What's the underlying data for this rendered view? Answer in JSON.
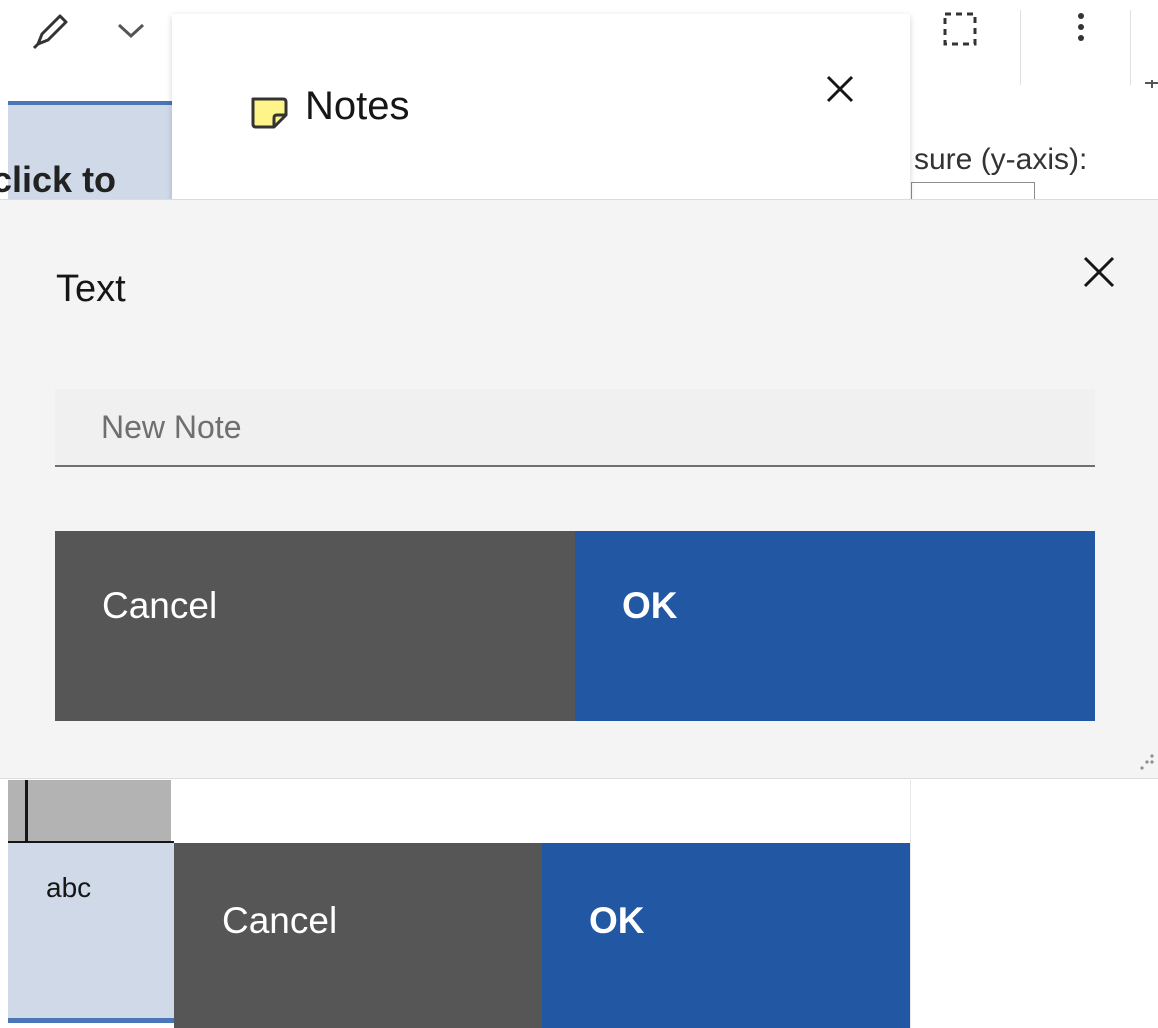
{
  "toolbar": {
    "icons": [
      "pen-icon",
      "chevron-down-icon",
      "select-region-icon",
      "overflow-menu-icon"
    ]
  },
  "canvas": {
    "partial_text": "click to"
  },
  "properties": {
    "partial_label": "sure (y-axis):"
  },
  "notes_panel": {
    "icon": "note-icon",
    "title": "Notes",
    "close_icon": "close-icon"
  },
  "text_dialog": {
    "title": "Text",
    "close_icon": "close-icon",
    "input": {
      "value": "",
      "placeholder": "New Note"
    },
    "cancel_label": "Cancel",
    "ok_label": "OK",
    "colors": {
      "cancel": "#565656",
      "ok": "#2257a4"
    }
  },
  "background_dialog": {
    "cell_text": "abc",
    "cancel_label": "Cancel",
    "ok_label": "OK"
  }
}
